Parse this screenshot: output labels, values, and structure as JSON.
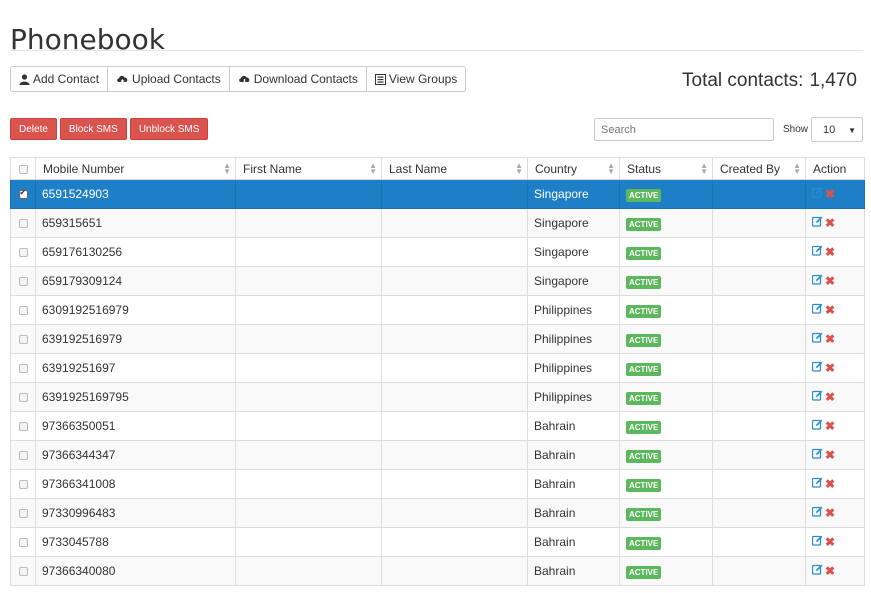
{
  "page": {
    "title": "Phonebook"
  },
  "toolbar": {
    "add_label": "Add Contact",
    "upload_label": "Upload Contacts",
    "download_label": "Download Contacts",
    "groups_label": "View Groups"
  },
  "total": {
    "label": "Total contacts:",
    "value": "1,470"
  },
  "actions": {
    "delete_label": "Delete",
    "block_label": "Block SMS",
    "unblock_label": "Unblock SMS"
  },
  "search": {
    "placeholder": "Search",
    "value": ""
  },
  "show": {
    "label": "Show",
    "value": "10"
  },
  "table": {
    "columns": [
      "Mobile Number",
      "First Name",
      "Last Name",
      "Country",
      "Status",
      "Created By",
      "Action"
    ],
    "rows": [
      {
        "mobile": "6591524903",
        "first": "",
        "last": "",
        "country": "Singapore",
        "status": "ACTIVE",
        "created_by": "",
        "selected": true
      },
      {
        "mobile": "659315651",
        "first": "",
        "last": "",
        "country": "Singapore",
        "status": "ACTIVE",
        "created_by": "",
        "selected": false
      },
      {
        "mobile": "659176130256",
        "first": "",
        "last": "",
        "country": "Singapore",
        "status": "ACTIVE",
        "created_by": "",
        "selected": false
      },
      {
        "mobile": "659179309124",
        "first": "",
        "last": "",
        "country": "Singapore",
        "status": "ACTIVE",
        "created_by": "",
        "selected": false
      },
      {
        "mobile": "6309192516979",
        "first": "",
        "last": "",
        "country": "Philippines",
        "status": "ACTIVE",
        "created_by": "",
        "selected": false
      },
      {
        "mobile": "639192516979",
        "first": "",
        "last": "",
        "country": "Philippines",
        "status": "ACTIVE",
        "created_by": "",
        "selected": false
      },
      {
        "mobile": "63919251697",
        "first": "",
        "last": "",
        "country": "Philippines",
        "status": "ACTIVE",
        "created_by": "",
        "selected": false
      },
      {
        "mobile": "6391925169795",
        "first": "",
        "last": "",
        "country": "Philippines",
        "status": "ACTIVE",
        "created_by": "",
        "selected": false
      },
      {
        "mobile": "97366350051",
        "first": "",
        "last": "",
        "country": "Bahrain",
        "status": "ACTIVE",
        "created_by": "",
        "selected": false
      },
      {
        "mobile": "97366344347",
        "first": "",
        "last": "",
        "country": "Bahrain",
        "status": "ACTIVE",
        "created_by": "",
        "selected": false
      },
      {
        "mobile": "97366341008",
        "first": "",
        "last": "",
        "country": "Bahrain",
        "status": "ACTIVE",
        "created_by": "",
        "selected": false
      },
      {
        "mobile": "97330996483",
        "first": "",
        "last": "",
        "country": "Bahrain",
        "status": "ACTIVE",
        "created_by": "",
        "selected": false
      },
      {
        "mobile": "9733045788",
        "first": "",
        "last": "",
        "country": "Bahrain",
        "status": "ACTIVE",
        "created_by": "",
        "selected": false
      },
      {
        "mobile": "97366340080",
        "first": "",
        "last": "",
        "country": "Bahrain",
        "status": "ACTIVE",
        "created_by": "",
        "selected": false
      }
    ]
  },
  "colors": {
    "selected_row": "#1e7fc7",
    "danger": "#d9534f",
    "success": "#5cb85c",
    "edit_icon": "#2a8bd6"
  },
  "icons": {
    "add": "user-icon",
    "upload": "cloud-upload-icon",
    "download": "cloud-download-icon",
    "groups": "list-icon",
    "edit": "edit-icon",
    "delete": "delete-icon"
  }
}
